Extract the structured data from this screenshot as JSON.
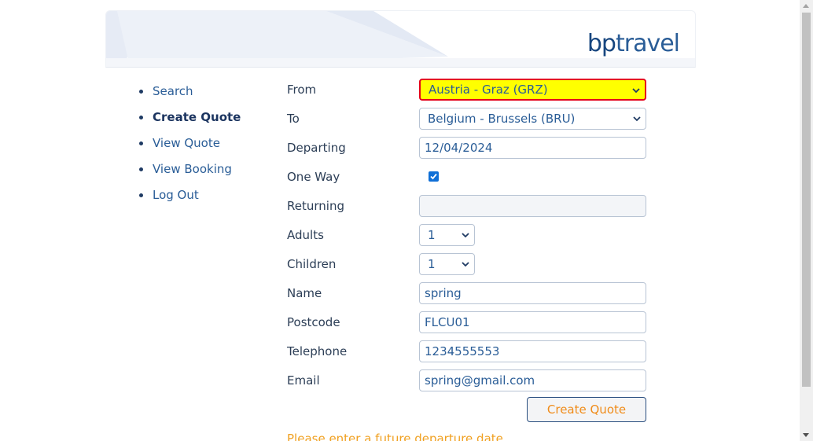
{
  "header": {
    "logo_bp": "bp",
    "logo_travel": "travel"
  },
  "nav": {
    "items": [
      {
        "label": "Search",
        "active": false
      },
      {
        "label": "Create Quote",
        "active": true
      },
      {
        "label": "View Quote",
        "active": false
      },
      {
        "label": "View Booking",
        "active": false
      },
      {
        "label": "Log Out",
        "active": false
      }
    ]
  },
  "form": {
    "from_label": "From",
    "from_value": "Austria - Graz (GRZ)",
    "to_label": "To",
    "to_value": "Belgium - Brussels (BRU)",
    "departing_label": "Departing",
    "departing_value": "12/04/2024",
    "oneway_label": "One Way",
    "oneway_checked": true,
    "returning_label": "Returning",
    "returning_value": "",
    "adults_label": "Adults",
    "adults_value": "1",
    "children_label": "Children",
    "children_value": "1",
    "name_label": "Name",
    "name_value": "spring",
    "postcode_label": "Postcode",
    "postcode_value": "FLCU01",
    "telephone_label": "Telephone",
    "telephone_value": "1234555553",
    "email_label": "Email",
    "email_value": "spring@gmail.com",
    "submit_label": "Create Quote",
    "error_message": "Please enter a future departure date"
  },
  "colors": {
    "link": "#2a5d97",
    "highlight_bg": "#ffff00",
    "highlight_border": "#e4001b",
    "button_text": "#f08c1a",
    "error_text": "#f0a020"
  }
}
